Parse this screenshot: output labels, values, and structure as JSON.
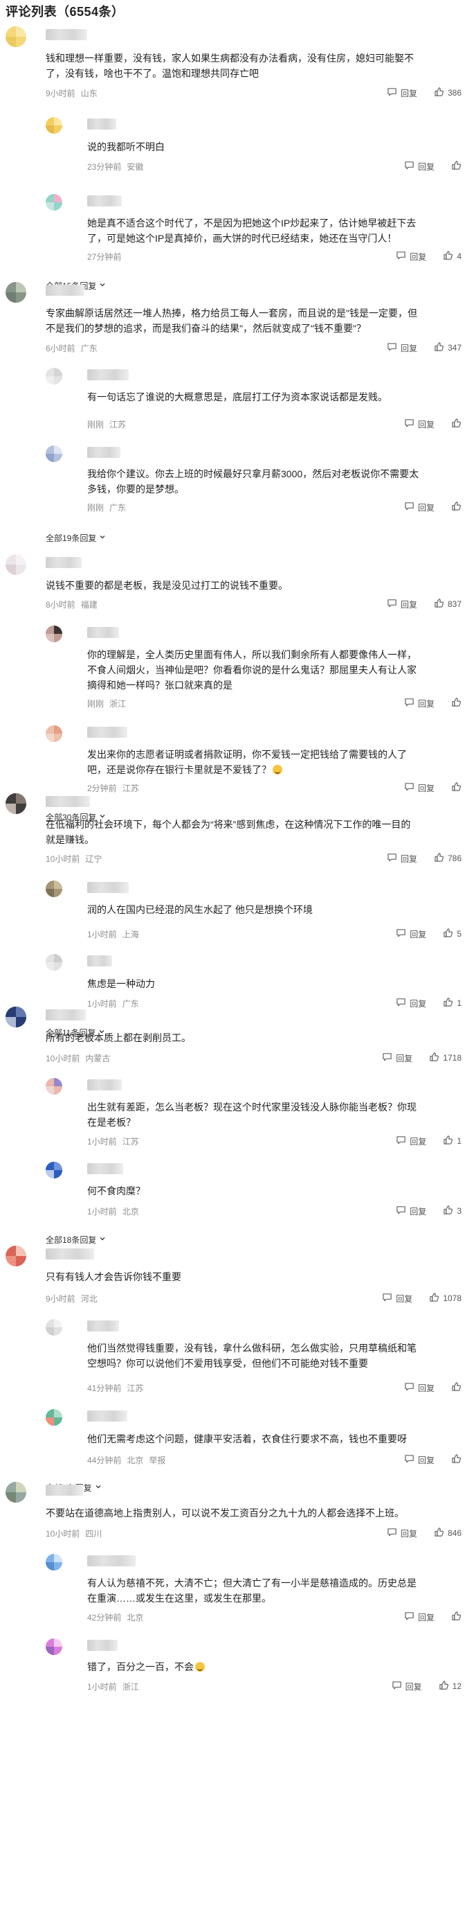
{
  "header": {
    "title": "评论列表（6554条）"
  },
  "ui": {
    "reply_label": "回复",
    "expand_suffix": ""
  },
  "threads": [
    {
      "main": {
        "text": "钱和理想一样重要，没有钱，家人如果生病都没有办法看病，没有住房，媳妇可能娶不了，没有钱，啥也干不了。温饱和理想共同存亡吧",
        "time": "9小时前",
        "loc": "山东",
        "likes": "386"
      },
      "replies": [
        {
          "text": "说的我都听不明白",
          "time": "23分钟前",
          "loc": "安徽",
          "likes": ""
        },
        {
          "text": "她是真不适合这个时代了，不是因为把她这个IP炒起来了，估计她早被赶下去了，可是她这个IP是真掉价，画大饼的时代已经结束，她还在当守门人！",
          "time": "27分钟前",
          "loc": "",
          "likes": "4"
        }
      ],
      "more": "全部15条回复"
    },
    {
      "main": {
        "text": "专家曲解原话居然还一堆人热捧，格力给员工每人一套房，而且说的是\"钱是一定要，但不是我们的梦想的追求，而是我们奋斗的结果\"，然后就变成了\"钱不重要\"？",
        "time": "6小时前",
        "loc": "广东",
        "likes": "347"
      },
      "replies": [
        {
          "text": "有一句话忘了谁说的大概意思是，底层打工仔为资本家说话都是发贱。",
          "time": "刚刚",
          "loc": "江苏",
          "likes": ""
        },
        {
          "text": "我给你个建议。你去上班的时候最好只拿月薪3000，然后对老板说你不需要太多钱，你要的是梦想。",
          "time": "刚刚",
          "loc": "广东",
          "likes": ""
        }
      ],
      "more": "全部19条回复"
    },
    {
      "main": {
        "text": "说钱不重要的都是老板，我是没见过打工的说钱不重要。",
        "time": "8小时前",
        "loc": "福建",
        "likes": "837"
      },
      "replies": [
        {
          "text": "你的理解是，全人类历史里面有伟人，所以我们剩余所有人都要像伟人一样，不食人间烟火，当神仙是吧？你看看你说的是什么鬼话？那屈里夫人有让人家摘得和她一样吗？张口就来真的是",
          "time": "刚刚",
          "loc": "浙江",
          "likes": ""
        },
        {
          "text": "发出来你的志愿者证明或者捐款证明，你不爱钱一定把钱给了需要钱的人了吧，还是说你存在银行卡里就是不爱钱了？",
          "time": "2分钟前",
          "loc": "江苏",
          "likes": "",
          "emoji": true
        }
      ],
      "more": "全部30条回复"
    },
    {
      "main": {
        "text": "在低福利的社会环境下，每个人都会为“将来”感到焦虑，在这种情况下工作的唯一目的就是赚钱。",
        "time": "10小时前",
        "loc": "辽宁",
        "likes": "786"
      },
      "replies": [
        {
          "text": "润的人在国内已经混的风生水起了 他只是想换个环境",
          "time": "1小时前",
          "loc": "上海",
          "likes": "5"
        },
        {
          "text": "焦虑是一种动力",
          "time": "1小时前",
          "loc": "广东",
          "likes": "1"
        }
      ],
      "more": "全部11条回复"
    },
    {
      "main": {
        "text": "所有的老板本质上都在剥削员工。",
        "time": "10小时前",
        "loc": "内蒙古",
        "likes": "1718"
      },
      "replies": [
        {
          "text": "出生就有差距，怎么当老板？现在这个时代家里没钱没人脉你能当老板？你现在是老板？",
          "time": "1小时前",
          "loc": "江苏",
          "likes": "1"
        },
        {
          "text": "何不食肉糜？",
          "time": "1小时前",
          "loc": "北京",
          "likes": "3"
        }
      ],
      "more": "全部18条回复"
    },
    {
      "main": {
        "text": "只有有钱人才会告诉你钱不重要",
        "time": "9小时前",
        "loc": "河北",
        "likes": "1078"
      },
      "replies": [
        {
          "text": "他们当然觉得钱重要，没有钱，拿什么做科研，怎么做实验，只用草稿纸和笔空想吗？你可以说他们不爱用钱享受，但他们不可能绝对钱不重要",
          "time": "41分钟前",
          "loc": "江苏",
          "likes": ""
        },
        {
          "text": "他们无需考虑这个问题，健康平安活着，衣食住行要求不高，钱也不重要呀",
          "time": "44分钟前",
          "loc": "北京",
          "likes": "",
          "report": "举报"
        }
      ],
      "more": "全部9条回复"
    },
    {
      "main": {
        "text": "不要站在道德高地上指责别人，可以说不发工资百分之九十九的人都会选择不上班。",
        "time": "10小时前",
        "loc": "四川",
        "likes": "846"
      },
      "replies": [
        {
          "text": "有人认为慈禧不死，大清不亡；但大清亡了有一小半是慈禧造成的。历史总是在重演……或发生在这里，或发生在那里。",
          "time": "42分钟前",
          "loc": "北京",
          "likes": ""
        },
        {
          "text": "错了，百分之一百，不会",
          "time": "1小时前",
          "loc": "浙江",
          "likes": "12",
          "emoji": true
        }
      ],
      "more": ""
    }
  ],
  "colors": {
    "meta": "#8e8e8e",
    "text": "#222222",
    "link": "#333333"
  }
}
